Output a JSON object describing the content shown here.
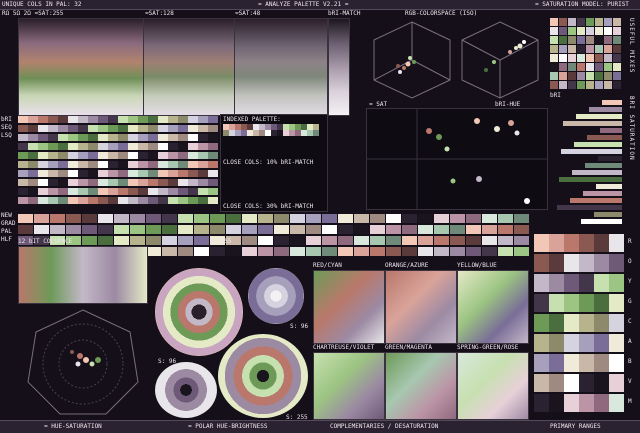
{
  "header": {
    "title": "≈ ANALYZE PALETTE V2.21 ≈",
    "unique_cols": "UNIQUE COLS IN PAL: 32",
    "model": "≈ SATURATION MODEL: PURIST",
    "sat_labels": [
      "RΩ 5Ω 2Ω ≈SAT:255",
      "≈SAT:128",
      "≈SAT:48",
      "bRI-MATCH"
    ]
  },
  "sections": {
    "rgb_colorspace": "RGB-COLORSPACE (ISO)",
    "sat": "≈ SAT",
    "bri_hue": "bRI-HUE",
    "bri": "bRI",
    "indexed_palette": "INDEXED PALETTE:",
    "close_cols_10": "CLOSE COLS: 10% bRI-MATCH",
    "close_cols_30": "CLOSE COLS: 30% bRI-MATCH",
    "colspace_12bit": "12 bIT COLSPACE",
    "s255_a": "S: 255",
    "s96_a": "S: 96",
    "s96_b": "S: 96",
    "s255_b": "S: 255",
    "left_side": [
      "bRI",
      "SEQ",
      "LSQ",
      "NEW",
      "GRAD",
      "PAL",
      "HLF"
    ]
  },
  "complementaries": [
    "RED/CYAN",
    "ORANGE/AZURE",
    "YELLOW/BLUE",
    "CHARTREUSE/VIOLET",
    "GREEN/MAGENTA",
    "SPRING-GREEN/ROSE"
  ],
  "right_vertical": {
    "useful_mixes": "USEFUL MIXES",
    "bri_saturation": "BRI SATURATION",
    "hues": [
      "R",
      "O",
      "Y",
      "G",
      "C",
      "A",
      "B",
      "V",
      "M"
    ]
  },
  "footer": {
    "hue_saturation": "≈ HUE-SATURATION",
    "polar": "≈ POLAR HUE-BRIGHTNESS",
    "complementaries": "COMPLEMENTARIES / DESATURATION",
    "primary_ranges": "PRIMARY RANGES"
  },
  "palette": [
    "#f2c7b6",
    "#d9a39a",
    "#b9786b",
    "#8a5a52",
    "#5a3a3a",
    "#e8e6ea",
    "#c3b8c8",
    "#9c8aa3",
    "#6e5a78",
    "#43364a",
    "#c7e0b0",
    "#9cc482",
    "#6e9a58",
    "#4a6e3e",
    "#e4e9c6",
    "#b7b38c",
    "#8c8a6a",
    "#d6d3e0",
    "#a7a0bc",
    "#7a6e98",
    "#f0ead8",
    "#c9b7a7",
    "#9e8a80",
    "#ffffff",
    "#2a2230",
    "#1a141e",
    "#e7d0d8",
    "#bb94a6",
    "#8f6a7e",
    "#d8e8dc",
    "#a7c7b0",
    "#6f8a79"
  ]
}
